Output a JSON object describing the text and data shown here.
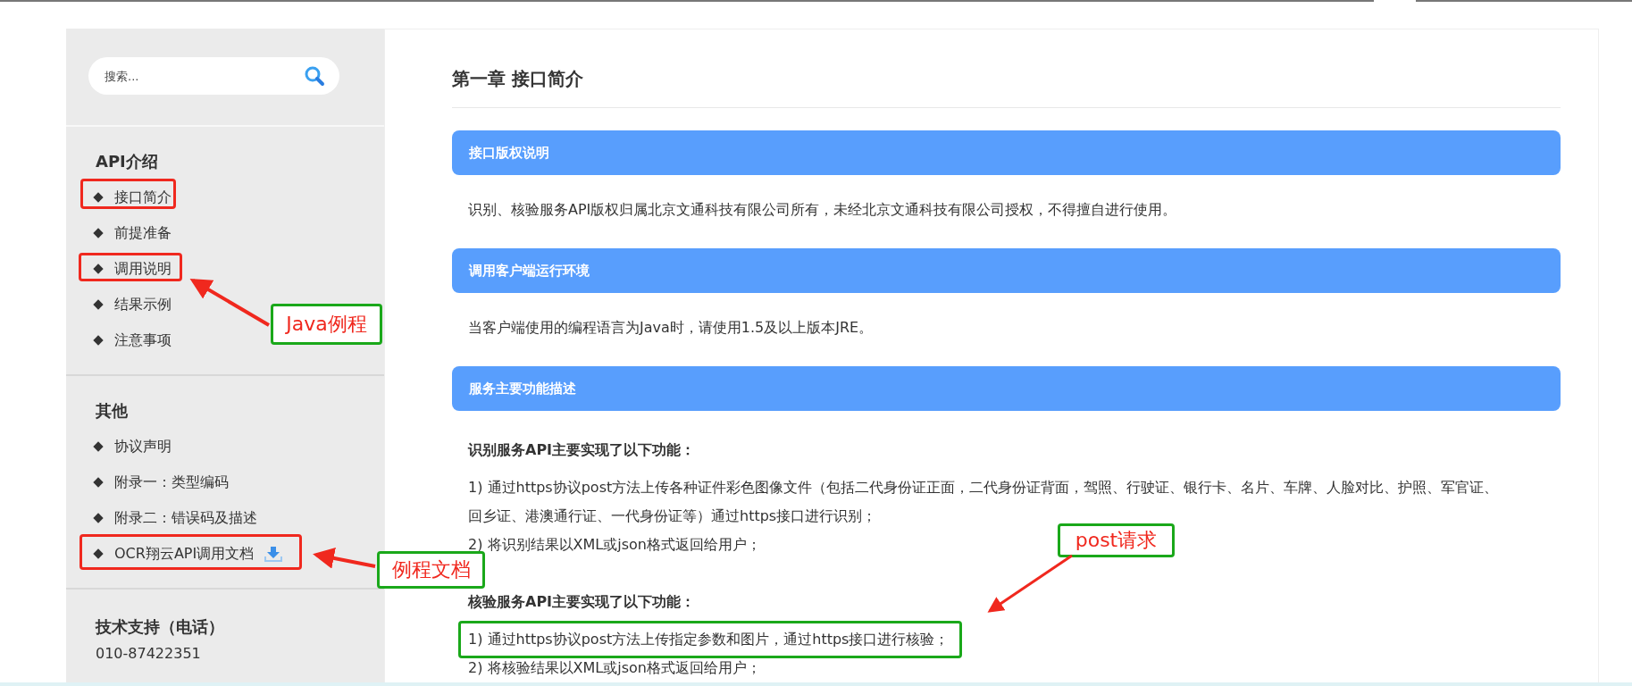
{
  "sidebar": {
    "search": {
      "placeholder": "搜索..."
    },
    "sections": [
      {
        "title": "API介绍",
        "items": [
          {
            "label": "接口简介",
            "kind": "link"
          },
          {
            "label": "前提准备",
            "kind": "link"
          },
          {
            "label": "调用说明",
            "kind": "link"
          },
          {
            "label": "结果示例",
            "kind": "link"
          },
          {
            "label": "注意事项",
            "kind": "link"
          }
        ]
      },
      {
        "title": "其他",
        "items": [
          {
            "label": "协议声明",
            "kind": "link"
          },
          {
            "label": "附录一：类型编码",
            "kind": "link"
          },
          {
            "label": "附录二：错误码及描述",
            "kind": "link"
          },
          {
            "label": "OCR翔云API调用文档",
            "kind": "download"
          }
        ]
      }
    ],
    "support": {
      "title": "技术支持（电话）",
      "phone": "010-87422351"
    }
  },
  "main": {
    "title": "第一章 接口简介",
    "blocks": [
      {
        "heading": "接口版权说明",
        "content": [
          {
            "kind": "text",
            "text": "识别、核验服务API版权归属北京文通科技有限公司所有，未经北京文通科技有限公司授权，不得擅自进行使用。"
          }
        ]
      },
      {
        "heading": "调用客户端运行环境",
        "content": [
          {
            "kind": "text",
            "text": "当客户端使用的编程语言为Java时，请使用1.5及以上版本JRE。"
          }
        ]
      },
      {
        "heading": "服务主要功能描述",
        "content": [
          {
            "kind": "bold",
            "text": "识别服务API主要实现了以下功能："
          },
          {
            "kind": "line",
            "text": "1) 通过https协议post方法上传各种证件彩色图像文件（包括二代身份证正面，二代身份证背面，驾照、行驶证、银行卡、名片、车牌、人脸对比、护照、军官证、回乡证、港澳通行证、一代身份证等）通过https接口进行识别；"
          },
          {
            "kind": "line",
            "text": "2) 将识别结果以XML或json格式返回给用户；"
          },
          {
            "kind": "bold",
            "text": "核验服务API主要实现了以下功能："
          },
          {
            "kind": "line",
            "text": "1) 通过https协议post方法上传指定参数和图片，通过https接口进行核验；",
            "highlighted": true
          },
          {
            "kind": "line",
            "text": "2) 将核验结果以XML或json格式返回给用户；"
          }
        ]
      }
    ]
  },
  "annotations": [
    {
      "label": "Java例程"
    },
    {
      "label": "例程文档"
    },
    {
      "label": "post请求"
    }
  ]
}
